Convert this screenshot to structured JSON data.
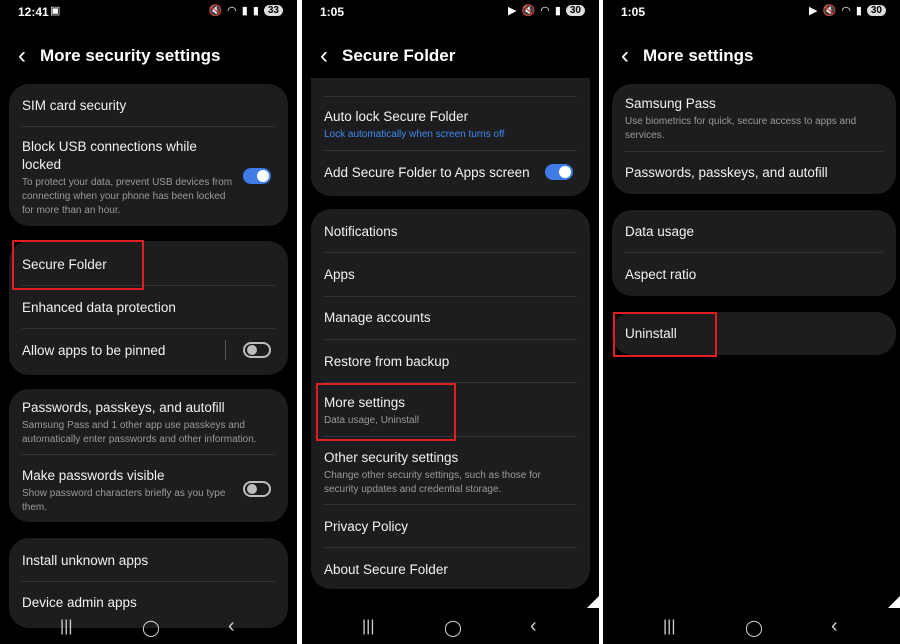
{
  "p1": {
    "status": {
      "time": "12:41",
      "badge": "33"
    },
    "title": "More security settings",
    "card1": {
      "sim": "SIM card security",
      "usb_title": "Block USB connections while locked",
      "usb_sub": "To protect your data, prevent USB devices from connecting when your phone has been locked for more than an hour.",
      "usb_toggle": true
    },
    "card2": {
      "secure_folder": "Secure Folder",
      "enhanced": "Enhanced data protection",
      "pin": "Allow apps to be pinned",
      "pin_toggle": false
    },
    "card3": {
      "passwords_title": "Passwords, passkeys, and autofill",
      "passwords_sub": "Samsung Pass and 1 other app use passkeys and automatically enter passwords and other information.",
      "visible_title": "Make passwords visible",
      "visible_sub": "Show password characters briefly as you type them.",
      "visible_toggle": false
    },
    "card4": {
      "install": "Install unknown apps",
      "device_admin": "Device admin apps"
    }
  },
  "p2": {
    "status": {
      "time": "1:05",
      "badge": "30"
    },
    "title": "Secure Folder",
    "card1": {
      "autolock_title": "Auto lock Secure Folder",
      "autolock_sub": "Lock automatically when screen turns off",
      "add_title": "Add Secure Folder to Apps screen",
      "add_toggle": true
    },
    "card2": {
      "notifications": "Notifications",
      "apps": "Apps",
      "accounts": "Manage accounts",
      "restore": "Restore from backup",
      "more_title": "More settings",
      "more_sub": "Data usage, Uninstall",
      "other_title": "Other security settings",
      "other_sub": "Change other security settings, such as those for security updates and credential storage.",
      "privacy": "Privacy Policy",
      "about": "About Secure Folder"
    }
  },
  "p3": {
    "status": {
      "time": "1:05",
      "badge": "30"
    },
    "title": "More settings",
    "card1": {
      "pass_title": "Samsung Pass",
      "pass_sub": "Use biometrics for quick, secure access to apps and services.",
      "passwords": "Passwords, passkeys, and autofill"
    },
    "card2": {
      "data": "Data usage",
      "aspect": "Aspect ratio"
    },
    "card3": {
      "uninstall": "Uninstall"
    }
  },
  "nav": {
    "recents": "|||",
    "home": "◯",
    "back": "‹"
  },
  "colors": {
    "accent": "#3f7ce8",
    "highlight": "#e02020",
    "card": "#1d1d1f"
  }
}
